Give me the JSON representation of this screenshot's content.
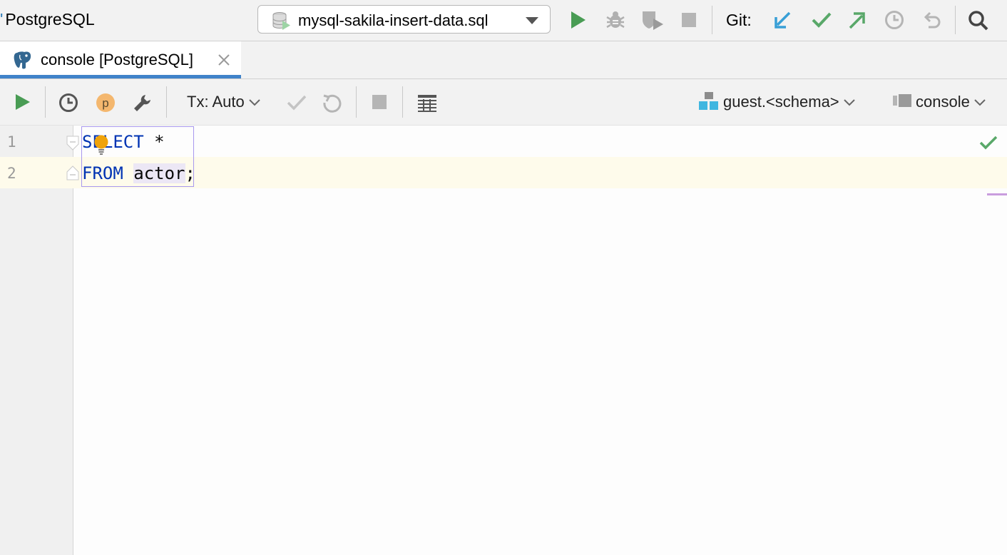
{
  "window": {
    "project_name": "PostgreSQL",
    "run_configuration": "mysql-sakila-insert-data.sql",
    "git_label": "Git:"
  },
  "tabs": [
    {
      "label": "console [PostgreSQL]",
      "active": true
    }
  ],
  "editor_toolbar": {
    "transaction_mode": "Tx: Auto",
    "schema": "guest.<schema>",
    "session": "console"
  },
  "editor": {
    "lines": [
      {
        "number": "1",
        "tokens": [
          {
            "text": "SELECT",
            "kind": "keyword"
          },
          {
            "text": " *",
            "kind": "plain"
          }
        ]
      },
      {
        "number": "2",
        "tokens": [
          {
            "text": "FROM",
            "kind": "keyword"
          },
          {
            "text": " ",
            "kind": "plain"
          },
          {
            "text": "actor",
            "kind": "identifier"
          },
          {
            "text": ";",
            "kind": "plain"
          }
        ]
      }
    ]
  },
  "icons": {
    "toolbar": [
      "run-icon",
      "debug-icon",
      "coverage-icon",
      "stop-icon"
    ],
    "git": [
      "git-update-icon",
      "git-commit-icon",
      "git-push-icon",
      "git-history-icon",
      "git-rollback-icon"
    ],
    "search": "search-icon",
    "editor_toolbar": [
      "execute-icon",
      "query-history-icon",
      "parameters-icon",
      "settings-wrench-icon",
      "commit-icon",
      "rollback-icon",
      "cancel-query-icon",
      "result-view-icon"
    ]
  },
  "colors": {
    "accent_blue": "#4083c9",
    "run_green": "#499c54",
    "keyword_blue": "#0033b3",
    "bulb_orange": "#f0a30a",
    "current_line": "#fefbeb",
    "selection_border": "#a898ee"
  }
}
